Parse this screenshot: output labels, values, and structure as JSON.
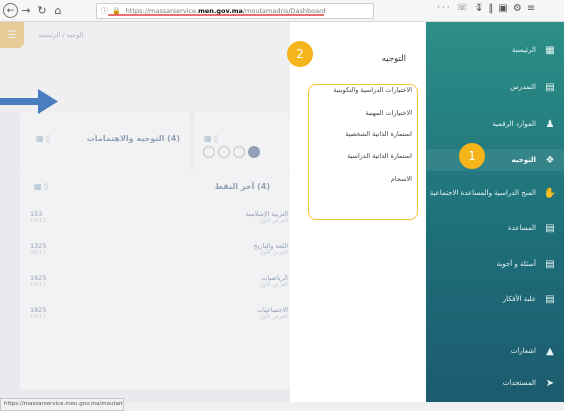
{
  "browser": {
    "url_prefix": "https://massarservice.",
    "url_domain": "men.gov.ma",
    "url_suffix": "/moutamadris/Dashboard",
    "status_url": "https://massarservice.men.gov.ma/moutamadris/"
  },
  "background": {
    "breadcrumb": "الوجيه  /  الرئيسية",
    "card1_title": "التوجيه والاهتمامات",
    "card1_num": "(4)",
    "card3_title": "آخر النقط",
    "card3_num": "(4)",
    "rows": [
      {
        "subject": "التربية الإسلامية",
        "sub": "الفرض الأول",
        "score": "153",
        "date": "15/12"
      },
      {
        "subject": "اللغة والتاريخ",
        "sub": "الفرض الأول",
        "score": "1325",
        "date": "26/11"
      },
      {
        "subject": "الرياضيات",
        "sub": "الفرض الأول",
        "score": "1625",
        "date": "19/11"
      },
      {
        "subject": "الاجتماعيات",
        "sub": "الفرض الأول",
        "score": "1825",
        "date": "10/11"
      }
    ]
  },
  "submenu": {
    "title": "التوجيه",
    "items": [
      "الاختيارات الدراسية والتكوينية",
      "الاختيارات المهنية",
      "استمارة الذاتية الشخصية",
      "استمارة الذاتية الدراسية",
      "الاسجام"
    ]
  },
  "sidebar": {
    "items": [
      {
        "label": "الرئيسية",
        "icon": "dashboard-icon"
      },
      {
        "label": "التمدرس",
        "icon": "book-icon"
      },
      {
        "label": "الموارد الرقمية",
        "icon": "people-icon"
      },
      {
        "label": "التوجيه",
        "icon": "compass-icon"
      },
      {
        "label": "المنح الدراسية والمساعدة الاجتماعية",
        "icon": "hand-icon"
      },
      {
        "label": "المساعدة",
        "icon": "help-icon"
      },
      {
        "label": "أسئلة و أجوبة",
        "icon": "faq-icon"
      },
      {
        "label": "علبة الأفكار",
        "icon": "idea-icon"
      },
      {
        "label": "اشعارات",
        "icon": "bell-icon"
      },
      {
        "label": "المستجدات",
        "icon": "news-icon"
      }
    ]
  },
  "annotations": {
    "badge1": "1",
    "badge2": "2"
  },
  "colors": {
    "sidebar": "#2c8f87",
    "accent": "#f4b41a",
    "arrow": "#4a7cc0"
  }
}
